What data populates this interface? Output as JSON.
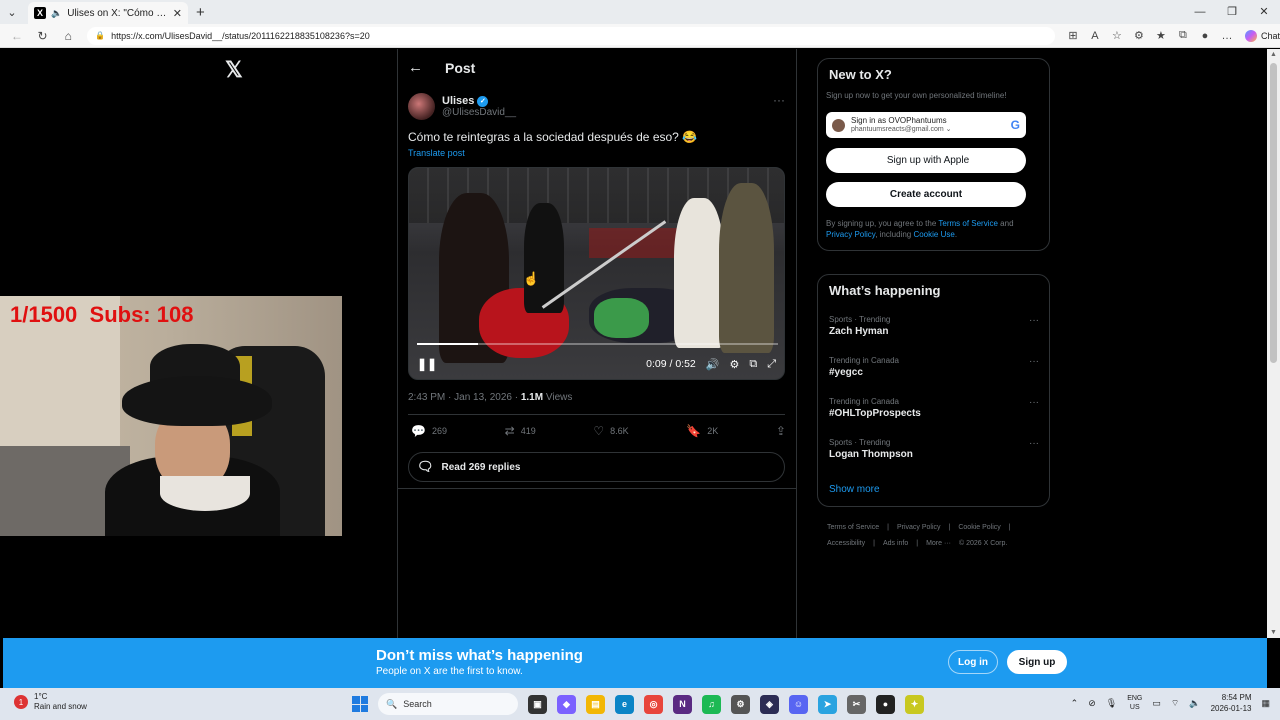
{
  "browser": {
    "tab_title": "Ulises on X: \"Cómo te reintegras a la sociedad después de eso?\"",
    "url": "https://x.com/UlisesDavid__/status/2011162218835108236?s=20",
    "chat_label": "Chat"
  },
  "header": {
    "title": "Post"
  },
  "post": {
    "author_name": "Ulises",
    "author_handle": "@UlisesDavid__",
    "text": "Cómo te reintegras a la sociedad después de eso? 😂",
    "translate_label": "Translate post",
    "video": {
      "time": "0:09 / 0:52",
      "progress": 0.17
    },
    "timestamp": "2:43 PM · Jan 13, 2026 · ",
    "views_count": "1.1M",
    "views_label": " Views",
    "replies": "269",
    "reposts": "419",
    "likes": "8.6K",
    "bookmarks": "2K",
    "read_replies": "Read 269 replies"
  },
  "signup_card": {
    "title": "New to X?",
    "subtitle": "Sign up now to get your own personalized timeline!",
    "google_name": "Sign in as OVOPhantuums",
    "google_email": "phantuumsreacts@gmail.com",
    "apple_label": "Sign up with Apple",
    "create_label": "Create account",
    "terms_prefix": "By signing up, you agree to the ",
    "terms_link": "Terms of Service",
    "terms_and": " and ",
    "privacy_link": "Privacy Policy",
    "terms_including": ", including ",
    "cookie_link": "Cookie Use",
    "terms_end": "."
  },
  "happening": {
    "title": "What’s happening",
    "trends": [
      {
        "category": "Sports · Trending",
        "name": "Zach Hyman"
      },
      {
        "category": "Trending in Canada",
        "name": "#yegcc"
      },
      {
        "category": "Trending in Canada",
        "name": "#OHLTopProspects"
      },
      {
        "category": "Sports · Trending",
        "name": "Logan Thompson"
      }
    ],
    "show_more": "Show more"
  },
  "footer": {
    "links": [
      "Terms of Service",
      "|",
      "Privacy Policy",
      "|",
      "Cookie Policy",
      "|",
      "Accessibility",
      "|",
      "Ads info",
      "|",
      "More ···",
      "© 2026 X Corp."
    ]
  },
  "banner": {
    "title": "Don’t miss what’s happening",
    "subtitle": "People on X are the first to know.",
    "login": "Log in",
    "signup": "Sign up"
  },
  "overlay": {
    "counter": "1/1500  Subs: 108"
  },
  "taskbar": {
    "temp": "1°C",
    "weather": "Rain and snow",
    "search": "Search",
    "lang_top": "ENG",
    "lang_bottom": "US",
    "time": "8:54 PM",
    "date": "2026-01-13"
  },
  "colors": {
    "accent": "#1d9bf0",
    "background": "#000000",
    "overlay_text": "#e01010"
  }
}
